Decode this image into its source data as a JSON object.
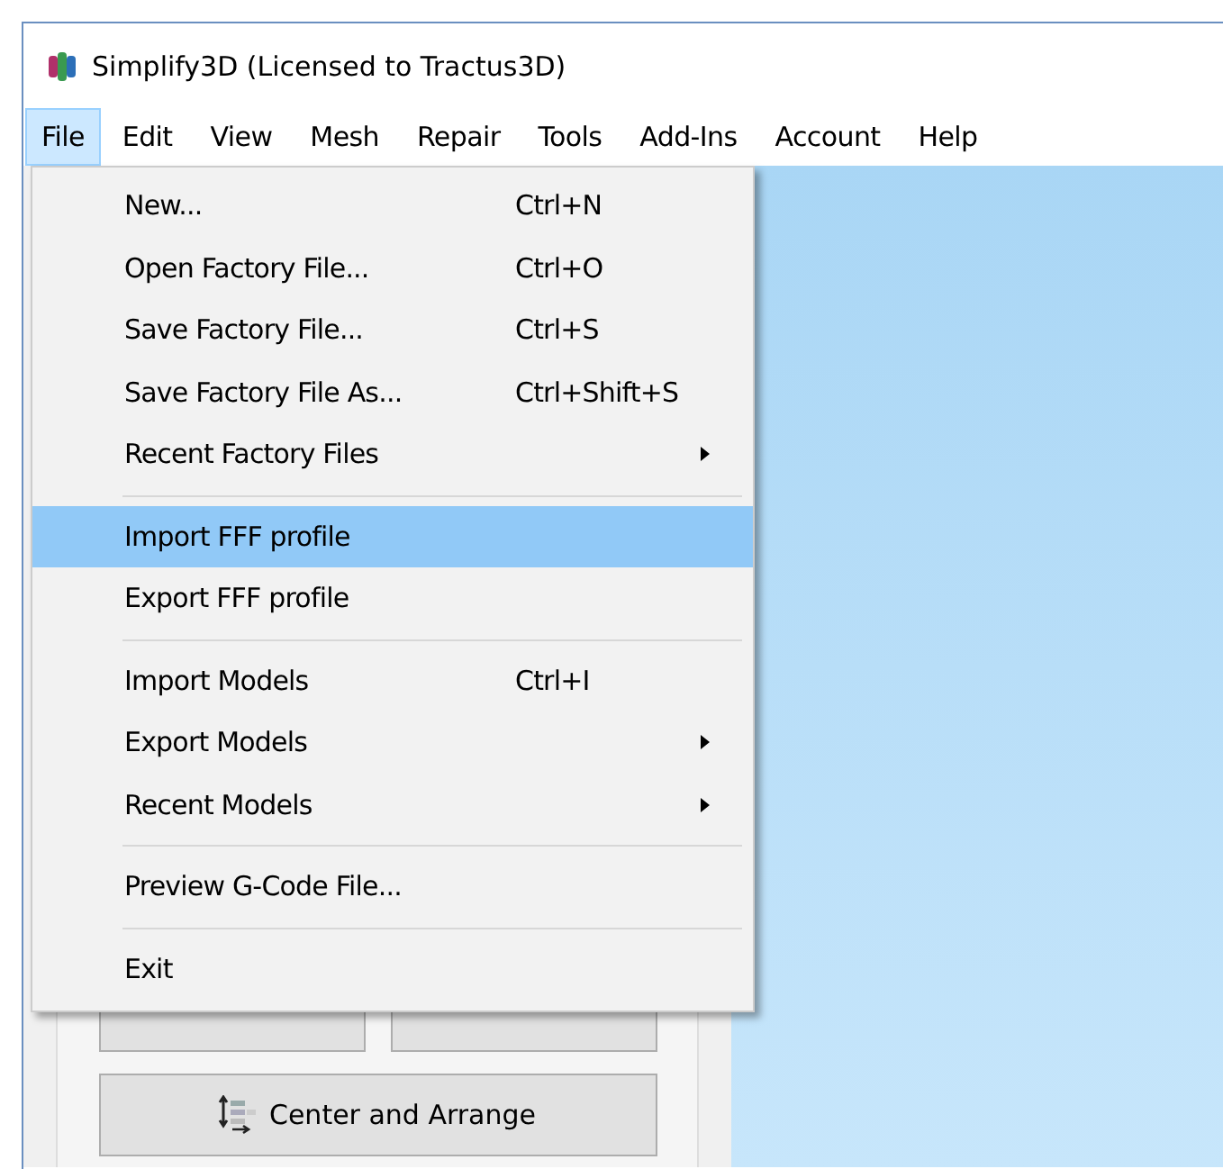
{
  "window": {
    "title": "Simplify3D (Licensed to Tractus3D)"
  },
  "menubar": [
    {
      "label": "File",
      "selected": true
    },
    {
      "label": "Edit",
      "selected": false
    },
    {
      "label": "View",
      "selected": false
    },
    {
      "label": "Mesh",
      "selected": false
    },
    {
      "label": "Repair",
      "selected": false
    },
    {
      "label": "Tools",
      "selected": false
    },
    {
      "label": "Add-Ins",
      "selected": false
    },
    {
      "label": "Account",
      "selected": false
    },
    {
      "label": "Help",
      "selected": false
    }
  ],
  "file_menu": [
    {
      "kind": "item",
      "label": "New...",
      "shortcut": "Ctrl+N",
      "submenu": false,
      "selected": false
    },
    {
      "kind": "item",
      "label": "Open Factory File...",
      "shortcut": "Ctrl+O",
      "submenu": false,
      "selected": false
    },
    {
      "kind": "item",
      "label": "Save Factory File...",
      "shortcut": "Ctrl+S",
      "submenu": false,
      "selected": false
    },
    {
      "kind": "item",
      "label": "Save Factory File As...",
      "shortcut": "Ctrl+Shift+S",
      "submenu": false,
      "selected": false
    },
    {
      "kind": "item",
      "label": "Recent Factory Files",
      "submenu": true,
      "selected": false
    },
    {
      "kind": "separator"
    },
    {
      "kind": "item",
      "label": "Import FFF profile",
      "submenu": false,
      "selected": true
    },
    {
      "kind": "item",
      "label": "Export FFF profile",
      "submenu": false,
      "selected": false
    },
    {
      "kind": "separator"
    },
    {
      "kind": "item",
      "label": "Import Models",
      "shortcut": "Ctrl+I",
      "submenu": false,
      "selected": false
    },
    {
      "kind": "item",
      "label": "Export Models",
      "submenu": true,
      "selected": false
    },
    {
      "kind": "item",
      "label": "Recent Models",
      "submenu": true,
      "selected": false
    },
    {
      "kind": "separator"
    },
    {
      "kind": "item",
      "label": "Preview G-Code File...",
      "submenu": false,
      "selected": false
    },
    {
      "kind": "separator"
    },
    {
      "kind": "item",
      "label": "Exit",
      "submenu": false,
      "selected": false
    }
  ],
  "side_panel": {
    "center_button": "Center and Arrange"
  }
}
